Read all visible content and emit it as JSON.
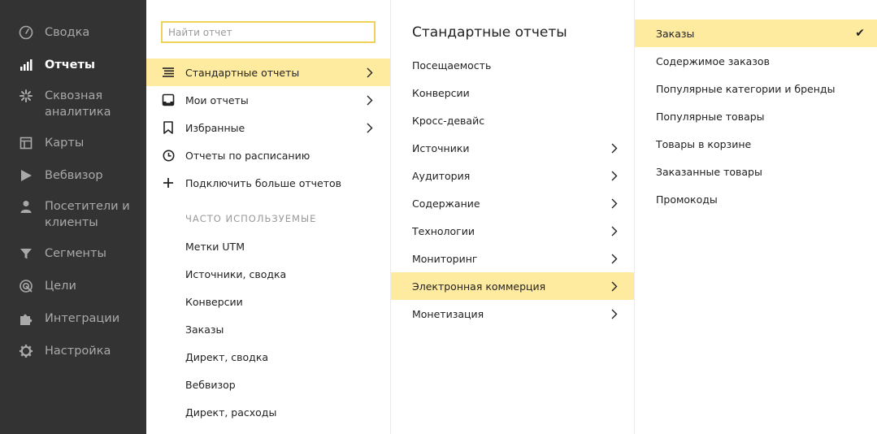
{
  "nav": {
    "items": [
      {
        "label": "Сводка",
        "icon": "gauge-icon"
      },
      {
        "label": "Отчеты",
        "icon": "bar-chart-icon"
      },
      {
        "label": "Сквозная аналитика",
        "icon": "snowflake-icon"
      },
      {
        "label": "Карты",
        "icon": "map-layout-icon"
      },
      {
        "label": "Вебвизор",
        "icon": "play-icon"
      },
      {
        "label": "Посетители и клиенты",
        "icon": "person-icon"
      },
      {
        "label": "Сегменты",
        "icon": "filter-icon"
      },
      {
        "label": "Цели",
        "icon": "target-icon"
      },
      {
        "label": "Интеграции",
        "icon": "puzzle-icon"
      },
      {
        "label": "Настройка",
        "icon": "gear-icon"
      }
    ],
    "active": "Отчеты"
  },
  "search": {
    "placeholder": "Найти отчет",
    "value": ""
  },
  "reports_menu": {
    "items": [
      {
        "label": "Стандартные отчеты",
        "icon": "list-icon",
        "has_submenu": true,
        "selected": true
      },
      {
        "label": "Мои отчеты",
        "icon": "inbox-icon",
        "has_submenu": true,
        "selected": false
      },
      {
        "label": "Избранные",
        "icon": "bookmark-icon",
        "has_submenu": true,
        "selected": false
      },
      {
        "label": "Отчеты по расписанию",
        "icon": "clock-icon",
        "has_submenu": false,
        "selected": false
      },
      {
        "label": "Подключить больше отчетов",
        "icon": "plus-icon",
        "has_submenu": false,
        "selected": false
      }
    ],
    "frequent_title": "ЧАСТО ИСПОЛЬЗУЕМЫЕ",
    "frequent": [
      "Метки UTM",
      "Источники, сводка",
      "Конверсии",
      "Заказы",
      "Директ, сводка",
      "Вебвизор",
      "Директ, расходы"
    ]
  },
  "standard_reports": {
    "title": "Стандартные отчеты",
    "items": [
      {
        "label": "Посещаемость",
        "has_submenu": false,
        "selected": false
      },
      {
        "label": "Конверсии",
        "has_submenu": false,
        "selected": false
      },
      {
        "label": "Кросс-девайс",
        "has_submenu": false,
        "selected": false
      },
      {
        "label": "Источники",
        "has_submenu": true,
        "selected": false
      },
      {
        "label": "Аудитория",
        "has_submenu": true,
        "selected": false
      },
      {
        "label": "Содержание",
        "has_submenu": true,
        "selected": false
      },
      {
        "label": "Технологии",
        "has_submenu": true,
        "selected": false
      },
      {
        "label": "Мониторинг",
        "has_submenu": true,
        "selected": false
      },
      {
        "label": "Электронная коммерция",
        "has_submenu": true,
        "selected": true
      },
      {
        "label": "Монетизация",
        "has_submenu": true,
        "selected": false
      }
    ]
  },
  "ecommerce_reports": {
    "items": [
      {
        "label": "Заказы",
        "selected": true,
        "checked": true
      },
      {
        "label": "Содержимое заказов",
        "selected": false,
        "checked": false
      },
      {
        "label": "Популярные категории и бренды",
        "selected": false,
        "checked": false
      },
      {
        "label": "Популярные товары",
        "selected": false,
        "checked": false
      },
      {
        "label": "Товары в корзине",
        "selected": false,
        "checked": false
      },
      {
        "label": "Заказанные товары",
        "selected": false,
        "checked": false
      },
      {
        "label": "Промокоды",
        "selected": false,
        "checked": false
      }
    ],
    "check_glyph": "✔"
  },
  "colors": {
    "nav_bg": "#333333",
    "highlight": "#ffeba0",
    "search_border": "#f0d159"
  }
}
